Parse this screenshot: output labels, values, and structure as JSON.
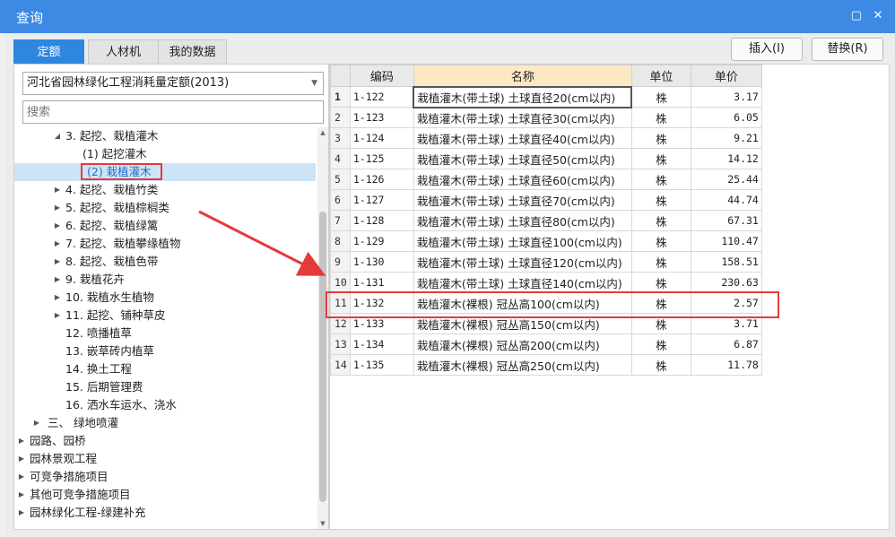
{
  "window": {
    "title": "查询"
  },
  "tabs": [
    {
      "label": "定额",
      "active": true
    },
    {
      "label": "人材机",
      "active": false
    },
    {
      "label": "我的数据",
      "active": false
    }
  ],
  "buttons": {
    "insert": "插入(I)",
    "replace": "替换(R)"
  },
  "library": {
    "selected": "河北省园林绿化工程消耗量定额(2013)"
  },
  "search": {
    "placeholder": "搜索"
  },
  "tree": [
    {
      "label": "3. 起挖、栽植灌木",
      "expanded": true
    },
    {
      "label": "(1) 起挖灌木"
    },
    {
      "label": "(2) 栽植灌木",
      "selected": true
    },
    {
      "label": "4. 起挖、栽植竹类"
    },
    {
      "label": "5. 起挖、栽植棕榈类"
    },
    {
      "label": "6. 起挖、栽植绿篱"
    },
    {
      "label": "7. 起挖、栽植攀缘植物"
    },
    {
      "label": "8. 起挖、栽植色带"
    },
    {
      "label": "9. 栽植花卉"
    },
    {
      "label": "10. 栽植水生植物"
    },
    {
      "label": "11. 起挖、铺种草皮"
    },
    {
      "label": "12. 喷播植草"
    },
    {
      "label": "13. 嵌草砖内植草"
    },
    {
      "label": "14. 换土工程"
    },
    {
      "label": "15. 后期管理费"
    },
    {
      "label": "16. 洒水车运水、浇水"
    },
    {
      "label": "三、 绿地喷灌"
    },
    {
      "label": "园路、园桥"
    },
    {
      "label": "园林景观工程"
    },
    {
      "label": "可竞争措施项目"
    },
    {
      "label": "其他可竞争措施项目"
    },
    {
      "label": "园林绿化工程-绿建补充"
    }
  ],
  "table": {
    "headers": {
      "code": "编码",
      "name": "名称",
      "unit": "单位",
      "price": "单价"
    },
    "rows": [
      {
        "num": "1",
        "code": "1-122",
        "name": "栽植灌木(带土球) 土球直径20(cm以内)",
        "unit": "株",
        "price": "3.17"
      },
      {
        "num": "2",
        "code": "1-123",
        "name": "栽植灌木(带土球) 土球直径30(cm以内)",
        "unit": "株",
        "price": "6.05"
      },
      {
        "num": "3",
        "code": "1-124",
        "name": "栽植灌木(带土球) 土球直径40(cm以内)",
        "unit": "株",
        "price": "9.21"
      },
      {
        "num": "4",
        "code": "1-125",
        "name": "栽植灌木(带土球) 土球直径50(cm以内)",
        "unit": "株",
        "price": "14.12"
      },
      {
        "num": "5",
        "code": "1-126",
        "name": "栽植灌木(带土球) 土球直径60(cm以内)",
        "unit": "株",
        "price": "25.44"
      },
      {
        "num": "6",
        "code": "1-127",
        "name": "栽植灌木(带土球) 土球直径70(cm以内)",
        "unit": "株",
        "price": "44.74"
      },
      {
        "num": "7",
        "code": "1-128",
        "name": "栽植灌木(带土球) 土球直径80(cm以内)",
        "unit": "株",
        "price": "67.31"
      },
      {
        "num": "8",
        "code": "1-129",
        "name": "栽植灌木(带土球) 土球直径100(cm以内)",
        "unit": "株",
        "price": "110.47"
      },
      {
        "num": "9",
        "code": "1-130",
        "name": "栽植灌木(带土球) 土球直径120(cm以内)",
        "unit": "株",
        "price": "158.51"
      },
      {
        "num": "10",
        "code": "1-131",
        "name": "栽植灌木(带土球) 土球直径140(cm以内)",
        "unit": "株",
        "price": "230.63"
      },
      {
        "num": "11",
        "code": "1-132",
        "name": "栽植灌木(裸根) 冠丛高100(cm以内)",
        "unit": "株",
        "price": "2.57"
      },
      {
        "num": "12",
        "code": "1-133",
        "name": "栽植灌木(裸根) 冠丛高150(cm以内)",
        "unit": "株",
        "price": "3.71"
      },
      {
        "num": "13",
        "code": "1-134",
        "name": "栽植灌木(裸根) 冠丛高200(cm以内)",
        "unit": "株",
        "price": "6.87"
      },
      {
        "num": "14",
        "code": "1-135",
        "name": "栽植灌木(裸根) 冠丛高250(cm以内)",
        "unit": "株",
        "price": "11.78"
      }
    ]
  },
  "colors": {
    "title_bar": "#3c8ae4",
    "active_tab": "#2f86df",
    "highlight": "#e53a3a",
    "name_header": "#fde8c4",
    "selected_row": "#cde4f7"
  }
}
